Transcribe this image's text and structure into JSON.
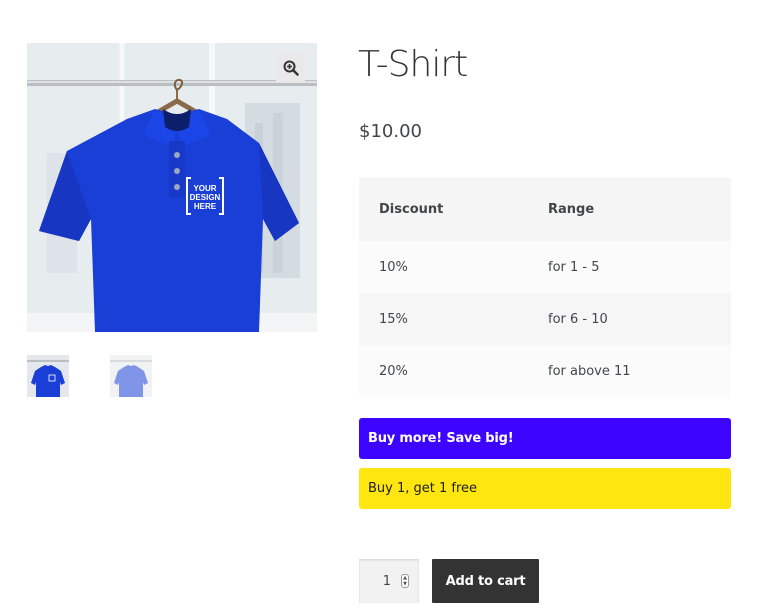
{
  "product": {
    "title": "T-Shirt",
    "price": "$10.00",
    "image_overlay_text": "YOUR DESIGN HERE",
    "main_image_color": "#1a3fd6",
    "alt_image_color": "#6e95e4"
  },
  "gallery": {
    "zoom_icon": "magnifier-plus-icon",
    "thumbnails": [
      {
        "name": "blue-polo-thumbnail"
      },
      {
        "name": "light-blue-polo-thumbnail"
      }
    ]
  },
  "discount_table": {
    "headers": [
      "Discount",
      "Range"
    ],
    "rows": [
      [
        "10%",
        "for 1 - 5"
      ],
      [
        "15%",
        "for 6 - 10"
      ],
      [
        "20%",
        "for above 11"
      ]
    ]
  },
  "promos": [
    {
      "text": "Buy more! Save big!",
      "bg": "#3d05ff",
      "color": "#ffffff"
    },
    {
      "text": "Buy 1, get 1 free",
      "bg": "#ffe611",
      "color": "#1d1d1d"
    }
  ],
  "cart": {
    "quantity": "1",
    "add_label": "Add to cart"
  }
}
